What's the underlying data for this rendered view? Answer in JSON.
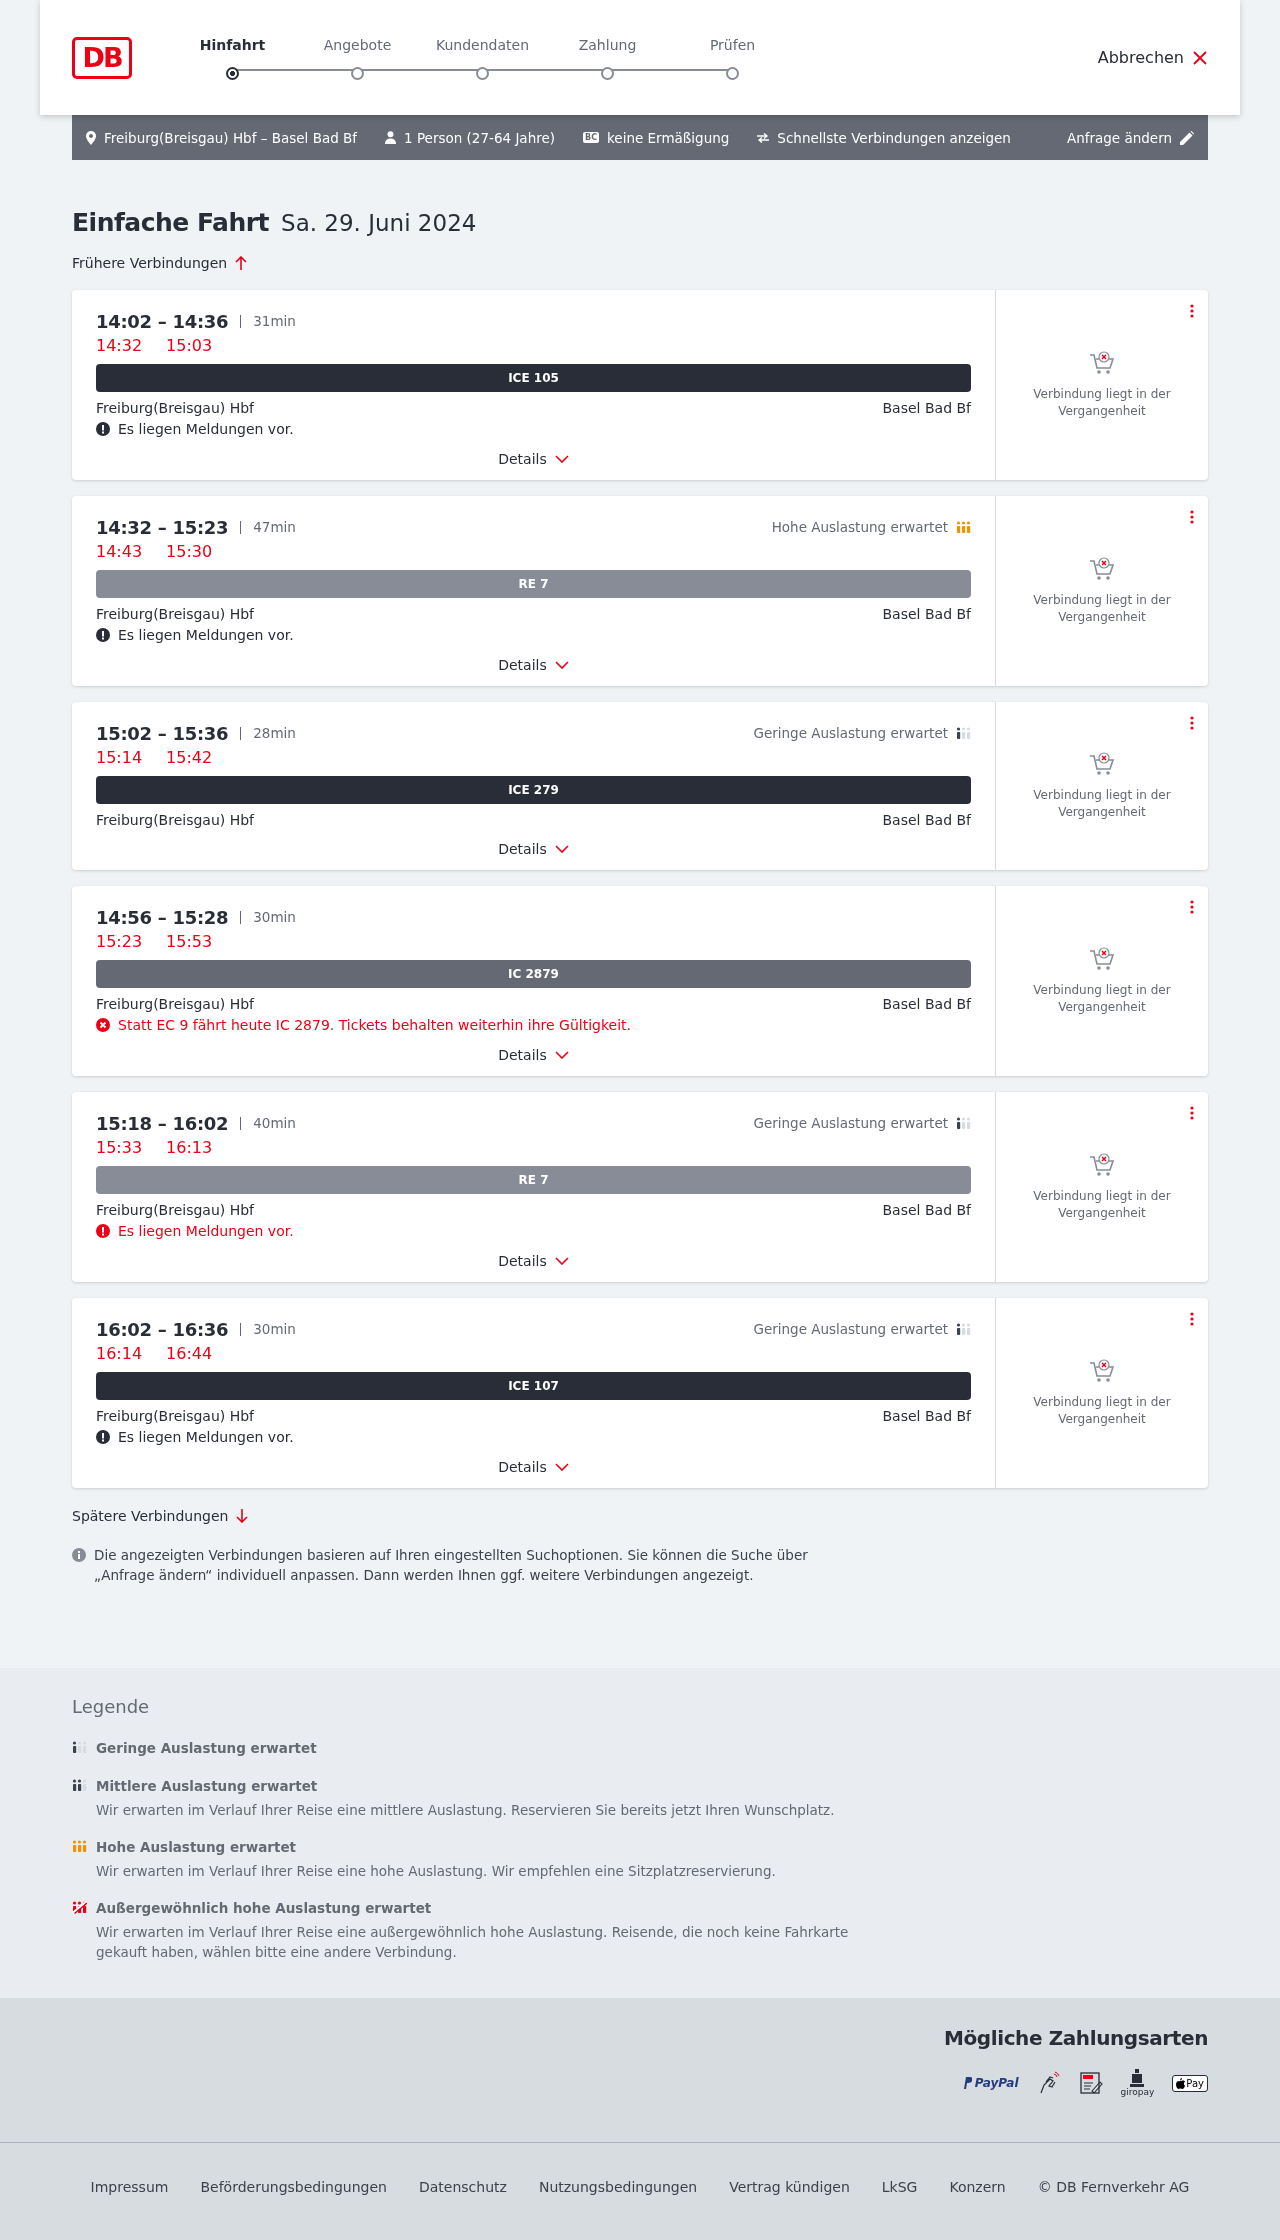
{
  "header": {
    "logo": "DB",
    "steps": [
      {
        "label": "Hinfahrt",
        "selected": true
      },
      {
        "label": "Angebote",
        "selected": false
      },
      {
        "label": "Kundendaten",
        "selected": false
      },
      {
        "label": "Zahlung",
        "selected": false
      },
      {
        "label": "Prüfen",
        "selected": false
      }
    ],
    "cancel": "Abbrechen"
  },
  "search_bar": {
    "items": [
      {
        "kind": "route",
        "text": "Freiburg(Breisgau) Hbf – Basel Bad Bf"
      },
      {
        "kind": "person",
        "text": "1 Person (27-64 Jahre)"
      },
      {
        "kind": "card",
        "badge": "BC",
        "text": "keine Ermäßigung"
      },
      {
        "kind": "filter",
        "text": "Schnellste Verbindungen anzeigen"
      }
    ],
    "edit": "Anfrage ändern"
  },
  "title": "Einfache Fahrt",
  "date": "Sa. 29. Juni 2024",
  "earlier": "Frühere Verbindungen",
  "connections": [
    {
      "times": "14:02 – 14:36",
      "duration": "31min",
      "realtime_departure": "14:32",
      "realtime_arrival": "15:03",
      "train": {
        "kind": "longdistance",
        "label": "ICE 105"
      },
      "from": "Freiburg(Breisgau) Hbf",
      "to": "Basel Bad Bf",
      "message": {
        "kind": "notice",
        "text": "Es liegen Meldungen vor."
      },
      "details": "Details",
      "status": "Verbindung liegt in der Vergangenheit"
    },
    {
      "times": "14:32 – 15:23",
      "duration": "47min",
      "realtime_departure": "14:43",
      "realtime_arrival": "15:30",
      "occupancy": {
        "kind": "high",
        "text": "Hohe Auslastung erwartet"
      },
      "train": {
        "kind": "regional",
        "label": "RE 7"
      },
      "from": "Freiburg(Breisgau) Hbf",
      "to": "Basel Bad Bf",
      "message": {
        "kind": "notice",
        "text": "Es liegen Meldungen vor."
      },
      "details": "Details",
      "status": "Verbindung liegt in der Vergangenheit"
    },
    {
      "times": "15:02 – 15:36",
      "duration": "28min",
      "realtime_departure": "15:14",
      "realtime_arrival": "15:42",
      "occupancy": {
        "kind": "low",
        "text": "Geringe Auslastung erwartet"
      },
      "train": {
        "kind": "longdistance",
        "label": "ICE 279"
      },
      "from": "Freiburg(Breisgau) Hbf",
      "to": "Basel Bad Bf",
      "details": "Details",
      "status": "Verbindung liegt in der Vergangenheit"
    },
    {
      "times": "14:56 – 15:28",
      "duration": "30min",
      "realtime_departure": "15:23",
      "realtime_arrival": "15:53",
      "train": {
        "kind": "intercity",
        "label": "IC 2879"
      },
      "from": "Freiburg(Breisgau) Hbf",
      "to": "Basel Bad Bf",
      "message": {
        "kind": "error",
        "text": "Statt EC 9 fährt heute IC 2879. Tickets behalten weiterhin ihre Gültigkeit."
      },
      "details": "Details",
      "status": "Verbindung liegt in der Vergangenheit"
    },
    {
      "times": "15:18 – 16:02",
      "duration": "40min",
      "realtime_departure": "15:33",
      "realtime_arrival": "16:13",
      "occupancy": {
        "kind": "low",
        "text": "Geringe Auslastung erwartet"
      },
      "train": {
        "kind": "regional",
        "label": "RE 7"
      },
      "from": "Freiburg(Breisgau) Hbf",
      "to": "Basel Bad Bf",
      "message": {
        "kind": "alert",
        "text": "Es liegen Meldungen vor."
      },
      "details": "Details",
      "status": "Verbindung liegt in der Vergangenheit"
    },
    {
      "times": "16:02 – 16:36",
      "duration": "30min",
      "realtime_departure": "16:14",
      "realtime_arrival": "16:44",
      "occupancy": {
        "kind": "low",
        "text": "Geringe Auslastung erwartet"
      },
      "train": {
        "kind": "longdistance",
        "label": "ICE 107"
      },
      "from": "Freiburg(Breisgau) Hbf",
      "to": "Basel Bad Bf",
      "message": {
        "kind": "notice",
        "text": "Es liegen Meldungen vor."
      },
      "details": "Details",
      "status": "Verbindung liegt in der Vergangenheit"
    }
  ],
  "later": "Spätere Verbindungen",
  "note": "Die angezeigten Verbindungen basieren auf Ihren eingestellten Suchoptionen. Sie können die Suche über „Anfrage ändern“ individuell anpassen. Dann werden Ihnen ggf. weitere Verbindungen angezeigt.",
  "legend": {
    "title": "Legende",
    "items": [
      {
        "kind": "low",
        "title": "Geringe Auslastung erwartet"
      },
      {
        "kind": "medium",
        "title": "Mittlere Auslastung erwartet",
        "text": "Wir erwarten im Verlauf Ihrer Reise eine mittlere Auslastung. Reservieren Sie bereits jetzt Ihren Wunschplatz."
      },
      {
        "kind": "high",
        "title": "Hohe Auslastung erwartet",
        "text": "Wir erwarten im Verlauf Ihrer Reise eine hohe Auslastung. Wir empfehlen eine Sitzplatzreservierung."
      },
      {
        "kind": "exceptional",
        "title": "Außergewöhnlich hohe Auslastung erwartet",
        "text": "Wir erwarten im Verlauf Ihrer Reise eine außergewöhnlich hohe Auslastung. Reisende, die noch keine Fahrkarte gekauft haben, wählen bitte eine andere Verbindung."
      }
    ]
  },
  "payment": {
    "title": "Mögliche Zahlungsarten",
    "methods": [
      {
        "kind": "paypal",
        "label": "PayPal"
      },
      {
        "kind": "creditcard"
      },
      {
        "kind": "sepa"
      },
      {
        "kind": "giropay",
        "label": "giropay"
      },
      {
        "kind": "applepay",
        "label": "Pay"
      }
    ]
  },
  "footer_links": [
    "Impressum",
    "Beförderungsbedingungen",
    "Datenschutz",
    "Nutzungsbedingungen",
    "Vertrag kündigen",
    "LkSG",
    "Konzern",
    "© DB Fernverkehr AG"
  ]
}
